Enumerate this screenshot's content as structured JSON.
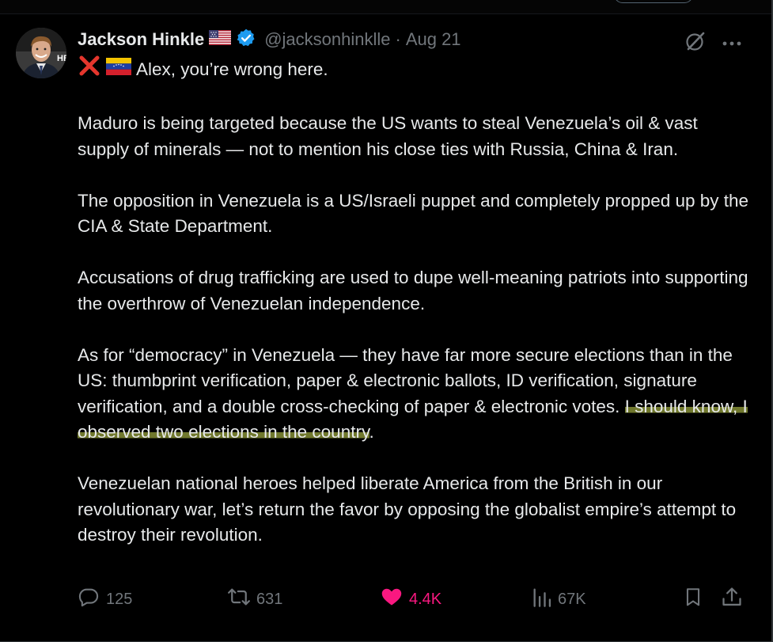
{
  "tweet": {
    "author": {
      "name": "Jackson Hinkle",
      "handle": "@jacksonhinklle",
      "separator": "·",
      "date": "Aug 21",
      "verified": true,
      "flag_icon": "us-flag-icon",
      "avatar_badge": "HB"
    },
    "body": {
      "emoji_icons": [
        "cross-mark-icon",
        "venezuela-flag-icon"
      ],
      "line1": "Alex, you’re wrong here.",
      "para1": "Maduro is being targeted because the US wants to steal Venezuela’s oil & vast supply of minerals — not to mention his close ties with Russia, China & Iran.",
      "para2": "The opposition in Venezuela is a US/Israeli puppet and completely propped up by the CIA & State Department.",
      "para3": "Accusations of drug trafficking are used to dupe well-meaning patriots into supporting the overthrow of Venezuelan independence.",
      "para4_start": "As for “democracy” in Venezuela — they have far more secure elections than in the US: thumbprint verification, paper & electronic ballots, ID verification, signature verification, and a double cross-checking of paper & electronic votes. ",
      "para4_highlight": "I should know, I observed two elections in the country",
      "para4_end": ".",
      "para5": "Venezuelan national heroes helped liberate America from the British in our revolutionary war, let’s return the favor by opposing the globalist empire’s attempt to destroy their revolution."
    },
    "actions": {
      "replies": "125",
      "reposts": "631",
      "likes": "4.4K",
      "views": "67K",
      "liked": true
    },
    "header_icons": [
      "grok-icon",
      "more-icon"
    ]
  },
  "colors": {
    "background": "#000000",
    "text": "#e7e9ea",
    "muted": "#71767b",
    "like": "#f91880",
    "verified": "#1d9bf0",
    "highlight": "#969c3c"
  }
}
